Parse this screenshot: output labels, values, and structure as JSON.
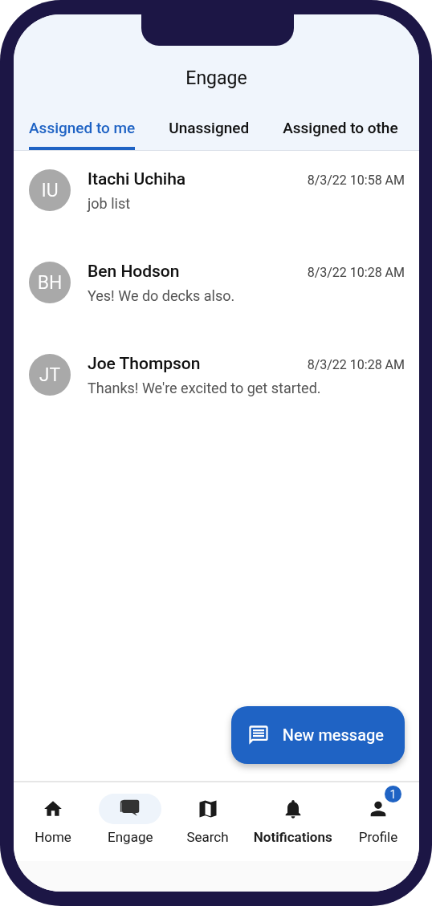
{
  "header": {
    "title": "Engage"
  },
  "tabs": [
    {
      "label": "Assigned to me",
      "selected": true
    },
    {
      "label": "Unassigned",
      "selected": false
    },
    {
      "label": "Assigned to othe",
      "selected": false
    }
  ],
  "conversations": [
    {
      "initials": "IU",
      "name": "Itachi Uchiha",
      "time": "8/3/22 10:58 AM",
      "message": "job list"
    },
    {
      "initials": "BH",
      "name": "Ben Hodson",
      "time": "8/3/22 10:28 AM",
      "message": "Yes! We do decks also."
    },
    {
      "initials": "JT",
      "name": "Joe Thompson",
      "time": "8/3/22 10:28 AM",
      "message": "Thanks! We're excited to get started."
    }
  ],
  "fab": {
    "label": "New message"
  },
  "bottom_nav": [
    {
      "kind": "home",
      "label": "Home",
      "selected": false
    },
    {
      "kind": "engage",
      "label": "Engage",
      "selected": true
    },
    {
      "kind": "search",
      "label": "Search",
      "selected": false
    },
    {
      "kind": "notifications",
      "label": "Notifications",
      "selected": false
    },
    {
      "kind": "profile",
      "label": "Profile",
      "selected": false,
      "badge": "1"
    }
  ]
}
